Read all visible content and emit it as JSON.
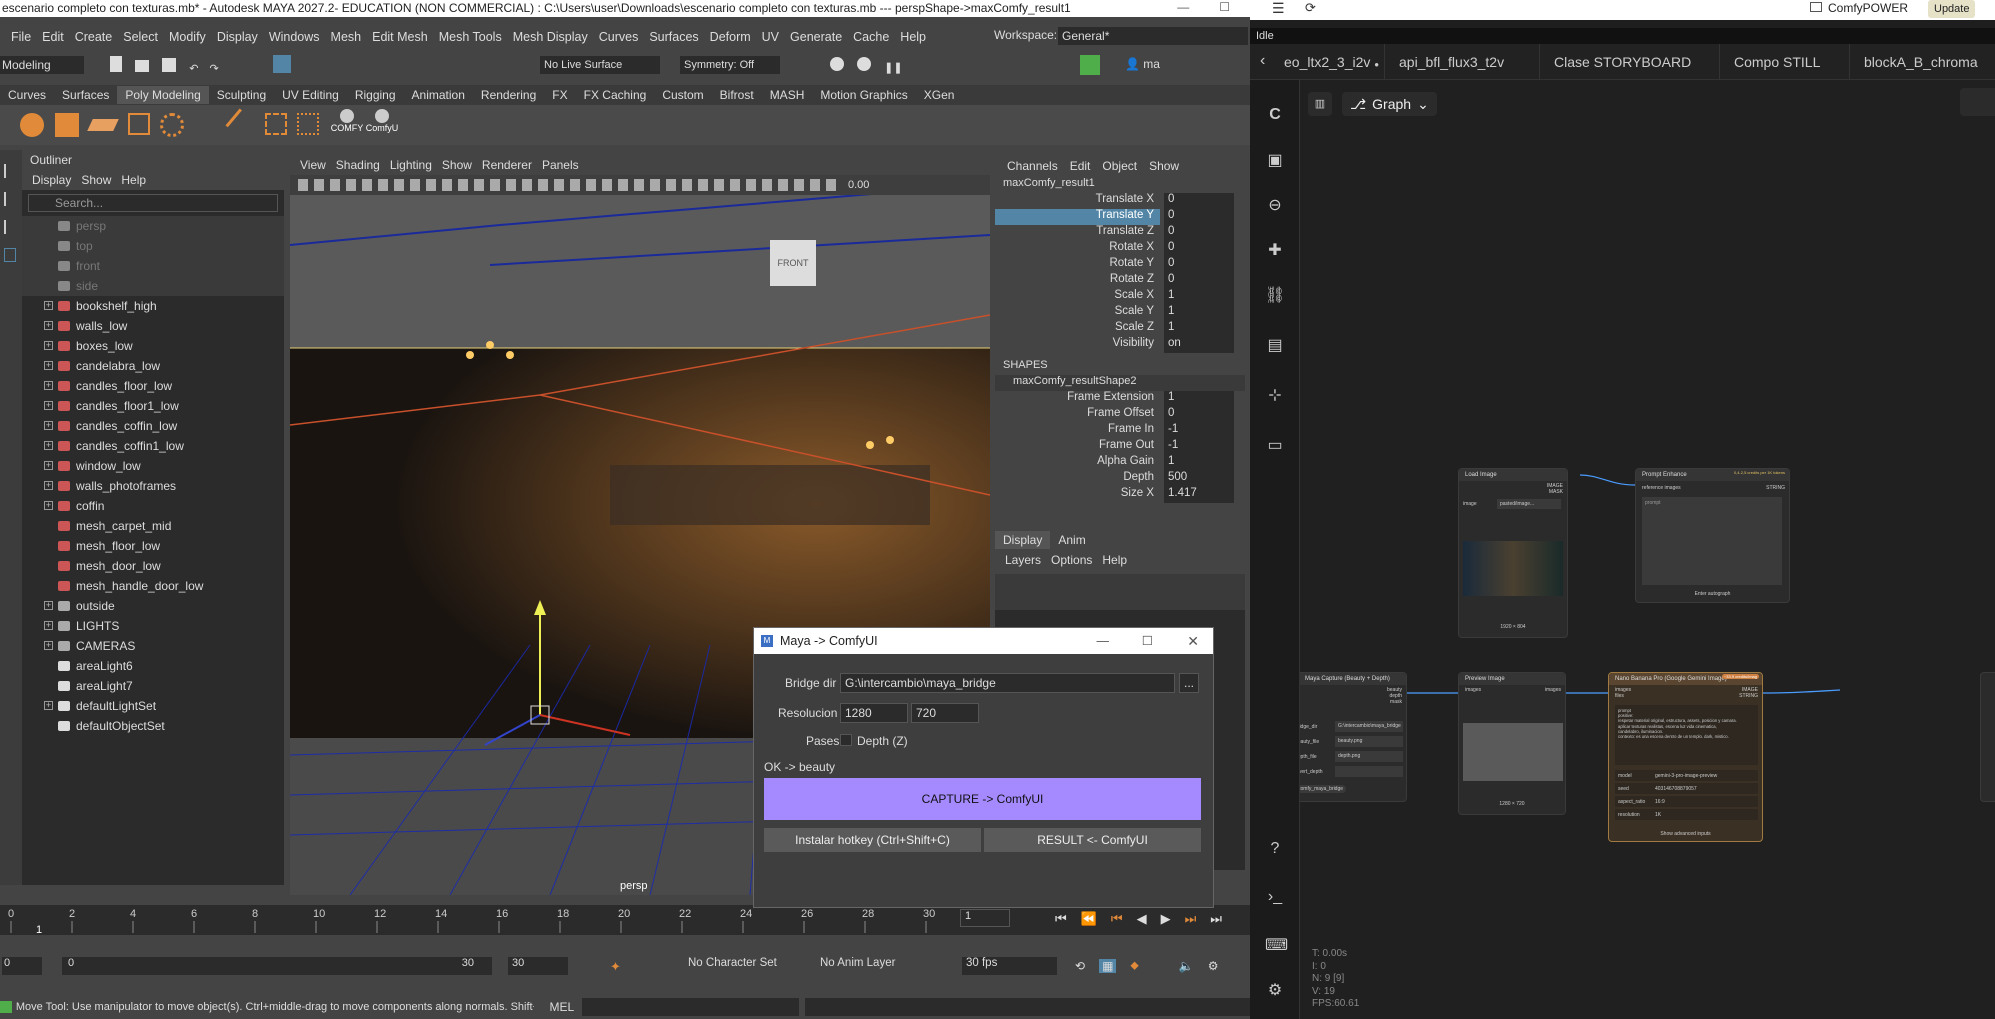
{
  "maya": {
    "title": "escenario completo con texturas.mb* - Autodesk MAYA 2027.2- EDUCATION (NON COMMERCIAL) : C:\\Users\\user\\Downloads\\escenario completo con texturas.mb   ---   perspShape->maxComfy_result1",
    "menus": [
      "File",
      "Edit",
      "Create",
      "Select",
      "Modify",
      "Display",
      "Windows",
      "Mesh",
      "Edit Mesh",
      "Mesh Tools",
      "Mesh Display",
      "Curves",
      "Surfaces",
      "Deform",
      "UV",
      "Generate",
      "Cache",
      "Help"
    ],
    "workspace_label": "Workspace:",
    "workspace_value": "General*",
    "mode": "Modeling",
    "live_surface": "No Live Surface",
    "symmetry": "Symmetry: Off",
    "shelf_tabs": [
      "Curves",
      "Surfaces",
      "Poly Modeling",
      "Sculpting",
      "UV Editing",
      "Rigging",
      "Animation",
      "Rendering",
      "FX",
      "FX Caching",
      "Custom",
      "Bifrost",
      "MASH",
      "Motion Graphics",
      "XGen"
    ],
    "active_shelf": "Poly Modeling",
    "shelf_labels": [
      "COMFY",
      "ComfyU"
    ],
    "outliner": {
      "title": "Outliner",
      "menus": [
        "Display",
        "Show",
        "Help"
      ],
      "search": "Search...",
      "items": [
        {
          "n": "persp",
          "t": "cam"
        },
        {
          "n": "top",
          "t": "cam"
        },
        {
          "n": "front",
          "t": "cam"
        },
        {
          "n": "side",
          "t": "cam"
        },
        {
          "n": "bookshelf_high",
          "t": "mesh"
        },
        {
          "n": "walls_low",
          "t": "mesh"
        },
        {
          "n": "boxes_low",
          "t": "mesh"
        },
        {
          "n": "candelabra_low",
          "t": "mesh"
        },
        {
          "n": "candles_floor_low",
          "t": "mesh"
        },
        {
          "n": "candles_floor1_low",
          "t": "mesh"
        },
        {
          "n": "candles_coffin_low",
          "t": "mesh"
        },
        {
          "n": "candles_coffin1_low",
          "t": "mesh"
        },
        {
          "n": "window_low",
          "t": "mesh"
        },
        {
          "n": "walls_photoframes",
          "t": "mesh"
        },
        {
          "n": "coffin",
          "t": "mesh"
        },
        {
          "n": "mesh_carpet_mid",
          "t": "leaf"
        },
        {
          "n": "mesh_floor_low",
          "t": "leaf"
        },
        {
          "n": "mesh_door_low",
          "t": "leaf"
        },
        {
          "n": "mesh_handle_door_low",
          "t": "leaf"
        },
        {
          "n": "outside",
          "t": "grp"
        },
        {
          "n": "LIGHTS",
          "t": "grp"
        },
        {
          "n": "CAMERAS",
          "t": "grp"
        },
        {
          "n": "areaLight6",
          "t": "light"
        },
        {
          "n": "areaLight7",
          "t": "light"
        },
        {
          "n": "defaultLightSet",
          "t": "set"
        },
        {
          "n": "defaultObjectSet",
          "t": "set"
        }
      ]
    },
    "viewport": {
      "menus": [
        "View",
        "Shading",
        "Lighting",
        "Show",
        "Renderer",
        "Panels"
      ],
      "cam_label": "persp",
      "cube_label": "FRONT",
      "value": "0.00"
    },
    "channels": {
      "menus": [
        "Channels",
        "Edit",
        "Object",
        "Show"
      ],
      "object": "maxComfy_result1",
      "attrs": [
        [
          "Translate X",
          "0"
        ],
        [
          "Translate Y",
          "0"
        ],
        [
          "Translate Z",
          "0"
        ],
        [
          "Rotate X",
          "0"
        ],
        [
          "Rotate Y",
          "0"
        ],
        [
          "Rotate Z",
          "0"
        ],
        [
          "Scale X",
          "1"
        ],
        [
          "Scale Y",
          "1"
        ],
        [
          "Scale Z",
          "1"
        ],
        [
          "Visibility",
          "on"
        ]
      ],
      "shapes_label": "SHAPES",
      "shape": "maxComfy_resultShape2",
      "shape_attrs": [
        [
          "Frame Extension",
          "1"
        ],
        [
          "Frame Offset",
          "0"
        ],
        [
          "Frame In",
          "-1"
        ],
        [
          "Frame Out",
          "-1"
        ],
        [
          "Alpha Gain",
          "1"
        ],
        [
          "Depth",
          "500"
        ],
        [
          "Size X",
          "1.417"
        ]
      ]
    },
    "layers": {
      "tabs": [
        "Display",
        "Anim"
      ],
      "menus": [
        "Layers",
        "Options",
        "Help"
      ]
    },
    "timeline": {
      "ticks": [
        "0",
        "2",
        "4",
        "6",
        "8",
        "10",
        "12",
        "14",
        "16",
        "18",
        "20",
        "22",
        "24",
        "26",
        "28",
        "30"
      ],
      "current": "1",
      "frame_field": "1"
    },
    "range": {
      "start": "0",
      "inner_start": "0",
      "inner_end": "30",
      "end": "30",
      "char_set": "No Character Set",
      "anim_layer": "No Anim Layer",
      "fps": "30 fps"
    },
    "help": "Move Tool: Use manipulator to move object(s). Ctrl+middle-drag to move components along normals. Shift+drag m",
    "mel": "MEL",
    "dialog": {
      "title": "Maya -> ComfyUI",
      "bridge_label": "Bridge dir",
      "bridge": "G:\\intercambio\\maya_bridge",
      "browse": "...",
      "res_label": "Resolucion",
      "w": "1280",
      "h": "720",
      "passes_label": "Pases",
      "depth_label": "Depth (Z)",
      "status": "OK -> beauty",
      "capture": "CAPTURE  ->  ComfyUI",
      "hotkey": "Instalar hotkey (Ctrl+Shift+C)",
      "result": "RESULT  <-  ComfyUI",
      "accent": "#a58aff"
    }
  },
  "comfy": {
    "brand": "ComfyPOWER",
    "update": "Update",
    "status": "Idle",
    "tabs": [
      "eo_ltx2_3_i2v",
      "api_bfl_flux3_t2v",
      "Clase STORYBOARD",
      "Compo STILL",
      "blockA_B_chroma"
    ],
    "graph_label": "Graph",
    "nodes": {
      "load": {
        "title": "Load Image",
        "image_label": "image",
        "image": "pasted/image...",
        "size": "1920 × 804",
        "out": [
          "IMAGE",
          "MASK"
        ]
      },
      "prompt": {
        "title": "Prompt Enhance",
        "cost": "0,4-2,5 credits per 1K tokens",
        "in": "reference images",
        "out": "STRING",
        "ph": "prompt",
        "btn": "Enter autograph"
      },
      "capture": {
        "title": "Maya Capture (Beauty + Depth)",
        "outs": [
          "beauty",
          "depth",
          "mask"
        ],
        "fields": [
          [
            "bridge_dir",
            "G:\\intercambio\\maya_bridge"
          ],
          [
            "beauty_file",
            "beauty.png"
          ],
          [
            "depth_file",
            "depth.png"
          ],
          [
            "invert_depth",
            ""
          ]
        ],
        "tag": "comfy_maya_bridge"
      },
      "preview": {
        "title": "Preview Image",
        "in": "images",
        "out": "images",
        "size": "1280 × 720"
      },
      "banana": {
        "title": "Nano Banana Pro (Google Gemini Image)",
        "cost": "~33,9 credits/Imag",
        "ins": [
          "images",
          "files"
        ],
        "outs": [
          "IMAGE",
          "STRING"
        ],
        "prompt": "prompt\npositive:\nrespetar material original, estructura, assets, posicion y camara.\naplicar texturas realistas, escena luz vida cinematica,\ncandelabro, iluminacion.\ncontexto: es una escena dentro de un templo. dark, mistico.",
        "fields": [
          [
            "model",
            "gemini-3-pro-image-preview"
          ],
          [
            "seed",
            "403146708879057"
          ],
          [
            "aspect_ratio",
            "16:9"
          ],
          [
            "resolution",
            "1K"
          ]
        ],
        "more": "Show advanced inputs"
      }
    },
    "stats": [
      "T: 0.00s",
      "I: 0",
      "N: 9 [9]",
      "V: 19",
      "FPS:60.61"
    ]
  }
}
